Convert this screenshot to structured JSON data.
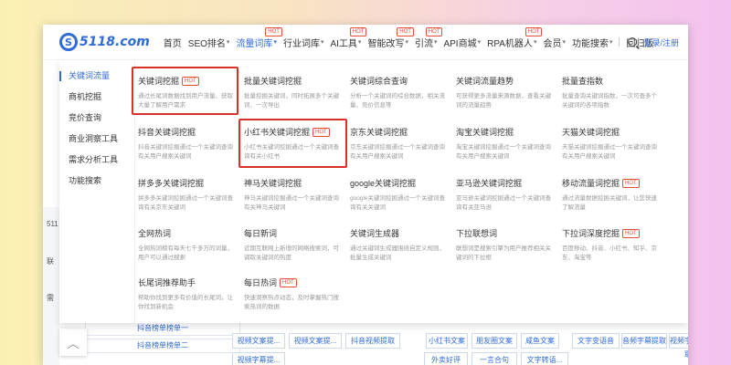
{
  "colors": {
    "accent": "#2f6bd8",
    "hot": "#e74c3c",
    "highlight": "#d9302c"
  },
  "logo": {
    "mark": "S",
    "text": "5118.com"
  },
  "nav": {
    "items": [
      {
        "label": "首页"
      },
      {
        "label": "SEO排名",
        "caret": "▾"
      },
      {
        "label": "流量词库",
        "caret": "▾",
        "hot": "HOT",
        "active": true
      },
      {
        "label": "行业词库",
        "caret": "▾"
      },
      {
        "label": "AI工具",
        "caret": "▾",
        "hot": "HOT"
      },
      {
        "label": "智能改写",
        "caret": "▾",
        "hot": "HOT"
      },
      {
        "label": "引流",
        "caret": "▾",
        "hot": "HOT"
      },
      {
        "label": "API商城",
        "caret": "▾"
      },
      {
        "label": "RPA机器人",
        "caret": "▾",
        "hot": "HOT"
      },
      {
        "label": "会员",
        "caret": "▾"
      },
      {
        "label": "功能搜索",
        "caret": "▾"
      },
      {
        "label": "回归版"
      }
    ],
    "login_label": "登录/注册"
  },
  "categories": [
    "关键词流量",
    "商机挖掘",
    "竞价查询",
    "商业洞察工具",
    "需求分析工具",
    "功能搜索"
  ],
  "tools": [
    {
      "title": "关键词挖掘",
      "hot": "HOT",
      "desc": "通过长尾词数据找到用户流量、获取大量了解用户需求"
    },
    {
      "title": "批量关键词挖掘",
      "desc": "批量挖掘关键词，同时拓展多个关键词、一次导出"
    },
    {
      "title": "关键词综合查询",
      "desc": "分析一个关键词的综合数据，相关流量、竞价信息等"
    },
    {
      "title": "关键词流量趋势",
      "desc": "可获得更多流量来源数据，查看关键词的流量趋势"
    },
    {
      "title": "批量查指数",
      "desc": "批量查询关键词指数，一次可查多个关键词的各项指数"
    },
    {
      "title": "抖音关键词挖掘",
      "desc": "抖音关键词挖掘通过一个关键词查询有关用户搜索关键词"
    },
    {
      "title": "小红书关键词挖掘",
      "hot": "HOT",
      "desc": "小红书关键词挖掘通过一个关键词查询有关小红书"
    },
    {
      "title": "京东关键词挖掘",
      "desc": "京东关键词挖掘通过一个关键词查询有关用户搜索关键词"
    },
    {
      "title": "淘宝关键词挖掘",
      "desc": "淘宝关键词挖掘通过一个关键词查询有关用户搜索关键词"
    },
    {
      "title": "天猫关键词挖掘",
      "desc": "天猫关键词挖掘通过一个关键词查询有关用户搜索关键词"
    },
    {
      "title": "拼多多关键词挖掘",
      "desc": "拼多多关键词挖掘通过一个关键词查询有关京东关键词"
    },
    {
      "title": "神马关键词挖掘",
      "desc": "神马关键词挖掘通过一个关键词查询有关神马关键词"
    },
    {
      "title": "google关键词挖掘",
      "desc": "google关键词挖掘通过一个关键词查询有关关键词"
    },
    {
      "title": "亚马逊关键词挖掘",
      "desc": "亚马逊关键词挖掘通过一个关键词查询有关亚马逊"
    },
    {
      "title": "移动流量词挖掘",
      "hot": "HOT",
      "desc": "通过流量数据挖掘关键词，让您快速了解流量"
    },
    {
      "title": "全网热词",
      "desc": "全网热词榜有每天七千多万的词量，用户可以通过搜索"
    },
    {
      "title": "每日新词",
      "desc": "近期互联网上新增的网络搜索词，可调取关键词的热度"
    },
    {
      "title": "关键词生成器",
      "desc": "通过关键词生成器围绕自定义规则，批量生成关键词"
    },
    {
      "title": "下拉联想词",
      "desc": "联想词是搜索引擎为用户推荐相关关键词的下拉框"
    },
    {
      "title": "下拉词深度挖掘",
      "hot": "HOT",
      "desc": "百度移动、抖音、小红书、知乎、京东、淘宝等"
    },
    {
      "title": "长尾词推荐助手",
      "desc": "帮助你找到更多有价值的长尾词，让你找到新机会"
    },
    {
      "title": "每日热词",
      "hot": "HOT",
      "desc": "快速洞察热点动态，及时掌握热门搜索热词的数据"
    }
  ],
  "background": {
    "rail": [
      "511",
      "联",
      "需"
    ],
    "list": [
      "抖音榜单榜单一",
      "抖音榜单榜单二"
    ],
    "tags": [
      "视频文案提...",
      "视频文案提...",
      "抖音视频提取",
      "小红书文案",
      "朋友圈文案",
      "咸鱼文案",
      "文字变语音",
      "音频字幕提取",
      "视频字幕提取",
      "视频字幕提...",
      "外卖好评",
      "一言合句",
      "文字转语..."
    ]
  }
}
